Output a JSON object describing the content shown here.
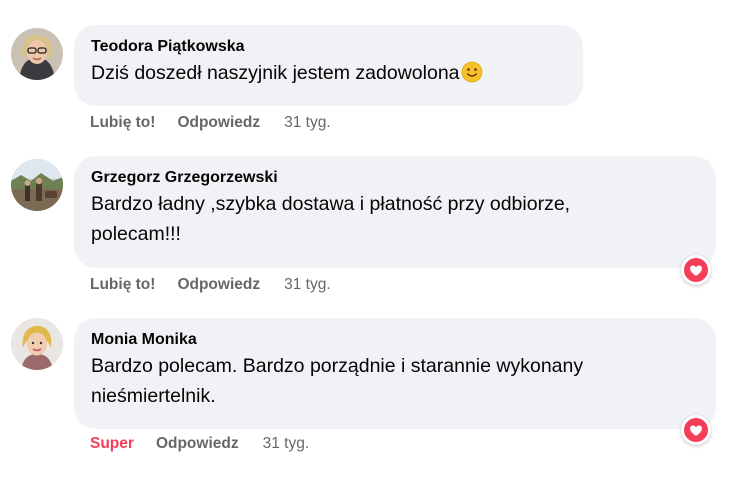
{
  "comments": [
    {
      "author": "Teodora Piątkowska",
      "text": "Dziś doszedł naszyjnik jestem zadowolona",
      "emoji": "slightly-smiling-face-emoji",
      "actions": {
        "like": "Lubię to!",
        "reply": "Odpowiedz",
        "time": "31 tyg."
      }
    },
    {
      "author": "Grzegorz Grzegorzewski",
      "text_line1": "Bardzo ładny ,szybka dostawa i płatność przy odbiorze,",
      "text_line2": "polecam!!!",
      "reaction": "heart-icon",
      "actions": {
        "like": "Lubię to!",
        "reply": "Odpowiedz",
        "time": "31 tyg."
      }
    },
    {
      "author": "Monia Monika",
      "text_line1": "Bardzo polecam. Bardzo porządnie i starannie wykonany",
      "text_line2": "nieśmiertelnik.",
      "reaction": "heart-icon",
      "actions": {
        "like": "Super",
        "reply": "Odpowiedz",
        "time": "31 tyg."
      }
    }
  ],
  "colors": {
    "bubble": "#f0f2f5",
    "text": "#050505",
    "meta": "#65676b",
    "super": "#f33e58",
    "heart": "#f33e58"
  }
}
